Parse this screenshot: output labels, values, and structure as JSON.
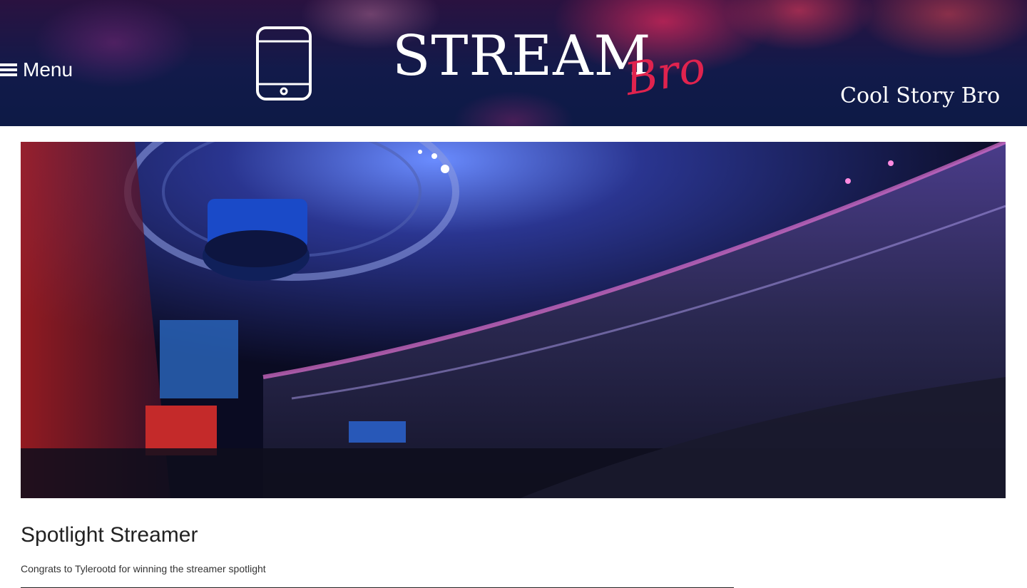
{
  "header": {
    "menu_label": "Menu",
    "logo_main": "STREAM",
    "logo_accent": "Bro",
    "tagline": "Cool Story Bro"
  },
  "hero": {
    "image": "esports-arena-photo"
  },
  "spotlight": {
    "title": "Spotlight Streamer",
    "text": "Congrats to Tylerootd for winning the streamer spotlight"
  },
  "colors": {
    "logo_accent": "#e0234e",
    "header_bg": "#121a4a",
    "text": "#222222"
  },
  "icons": [
    "hamburger-icon",
    "tablet-icon"
  ]
}
